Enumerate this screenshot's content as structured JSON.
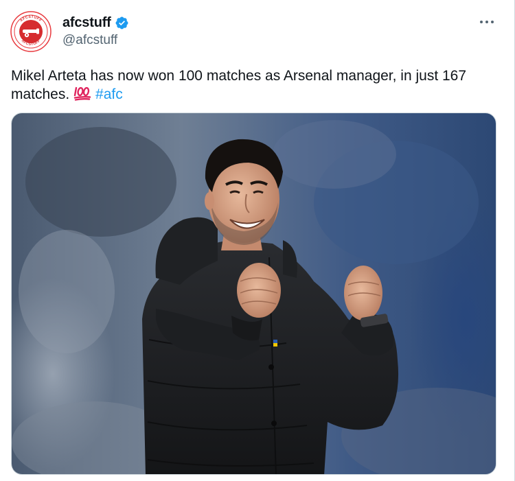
{
  "user": {
    "display_name": "afcstuff",
    "handle": "@afcstuff",
    "verified": true,
    "avatar": {
      "icon": "arsenal-cannon-logo",
      "ring_text_top": "AFCSTUFF",
      "ring_text_bottom": "AFCSTUFF",
      "ring_color": "#e8383d",
      "fill_color": "#d62c2f"
    }
  },
  "tweet": {
    "text": "Mikel Arteta has now won 100 matches as Arsenal manager, in just 167 matches.",
    "emoji": "💯",
    "hashtag": "#afc"
  },
  "menu_icon": "more-horizontal-icon",
  "colors": {
    "link": "#1d9bf0",
    "verified": "#1d9bf0",
    "secondary_text": "#536471"
  },
  "media": {
    "kind": "photo",
    "subject": "man-in-black-coat-celebrating-with-raised-fists"
  }
}
